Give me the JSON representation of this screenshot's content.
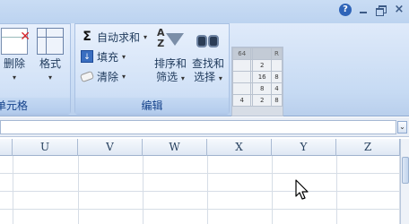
{
  "titlebar": {
    "help_icon": "help-icon",
    "help_label": "?",
    "close_label": "×"
  },
  "ribbon": {
    "cells_group": {
      "label": "单元格",
      "delete_button": "删除",
      "format_button": "格式"
    },
    "editing_group": {
      "label": "编辑",
      "autosum_button": "自动求和",
      "fill_button": "填充",
      "clear_button": "清除",
      "sort_filter_line1": "排序和",
      "sort_filter_line2": "筛选",
      "find_select_line1": "查找和",
      "find_select_line2": "选择"
    },
    "style_preview": {
      "header": [
        "64",
        "",
        "R"
      ],
      "rows": [
        [
          "",
          "",
          "2",
          ""
        ],
        [
          "",
          "",
          "16",
          "8"
        ],
        [
          "",
          "",
          "8",
          "4"
        ],
        [
          "4",
          "",
          "2",
          "8"
        ]
      ]
    }
  },
  "column_headers": [
    "U",
    "V",
    "W",
    "X",
    "Y",
    "Z"
  ],
  "accent": "#15428b"
}
